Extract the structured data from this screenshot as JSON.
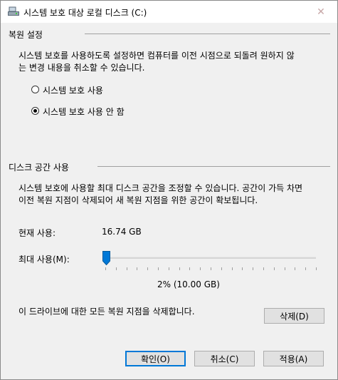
{
  "window": {
    "title": "시스템 보호 대상 로컬 디스크 (C:)"
  },
  "restore_settings": {
    "heading": "복원 설정",
    "description_line1": "시스템 보호를 사용하도록 설정하면 컴퓨터를 이전 시점으로 되돌려 원하지 않",
    "description_line2": "는 변경 내용을 취소할 수 있습니다.",
    "options": [
      {
        "label": "시스템 보호 사용",
        "checked": false
      },
      {
        "label": "시스템 보호 사용 안 함",
        "checked": true
      }
    ]
  },
  "disk_usage": {
    "heading": "디스크 공간 사용",
    "description_line1": "시스템 보호에 사용할 최대 디스크 공간을 조정할 수 있습니다. 공간이 가득 차면",
    "description_line2": "이전 복원 지점이 삭제되어 새 복원 지점을 위한 공간이 확보됩니다.",
    "current_label": "현재 사용:",
    "current_value": "16.74 GB",
    "max_label": "최대 사용(M):",
    "max_value_text": "2% (10.00 GB)",
    "max_fraction": 0.02,
    "delete_text": "이 드라이브에 대한 모든 복원 지점을 삭제합니다.",
    "delete_button": "삭제(D)"
  },
  "footer": {
    "ok": "확인(O)",
    "cancel": "취소(C)",
    "apply": "적용(A)"
  },
  "colors": {
    "accent": "#0078d7",
    "thumb": "#0078d7"
  }
}
